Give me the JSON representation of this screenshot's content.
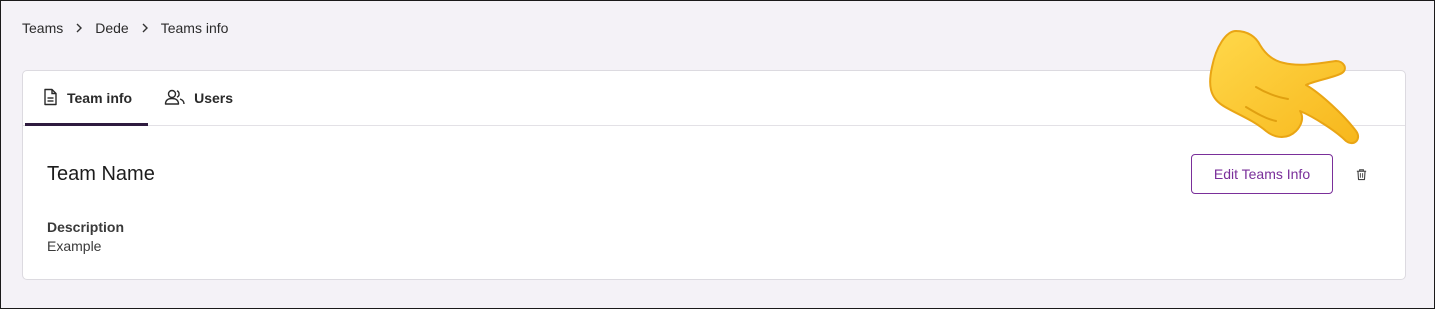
{
  "breadcrumb": {
    "items": [
      "Teams",
      "Dede",
      "Teams info"
    ]
  },
  "tabs": [
    {
      "label": "Team info",
      "icon": "document-icon",
      "active": true
    },
    {
      "label": "Users",
      "icon": "users-icon",
      "active": false
    }
  ],
  "team": {
    "name": "Team Name",
    "description_label": "Description",
    "description_value": "Example"
  },
  "actions": {
    "edit_label": "Edit Teams Info",
    "delete_icon": "trash-icon"
  },
  "colors": {
    "accent": "#7a2f9a",
    "tab_indicator": "#2f1b3f",
    "page_bg": "#f4f2f7"
  }
}
